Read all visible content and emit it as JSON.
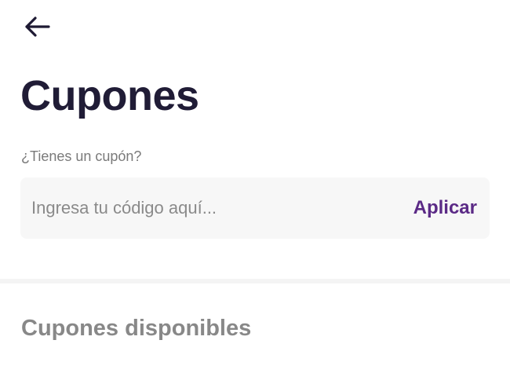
{
  "header": {
    "back_icon": "arrow-left-icon",
    "title": "Cupones"
  },
  "coupon_form": {
    "question": "¿Tienes un cupón?",
    "input_value": "",
    "input_placeholder": "Ingresa tu código aquí...",
    "apply_label": "Aplicar"
  },
  "available_section": {
    "title": "Cupones disponibles"
  },
  "colors": {
    "title": "#201c36",
    "accent": "#5b2a86",
    "muted_text": "#7a7a7a",
    "input_background": "#f7f7f7",
    "section_title": "#888888"
  }
}
